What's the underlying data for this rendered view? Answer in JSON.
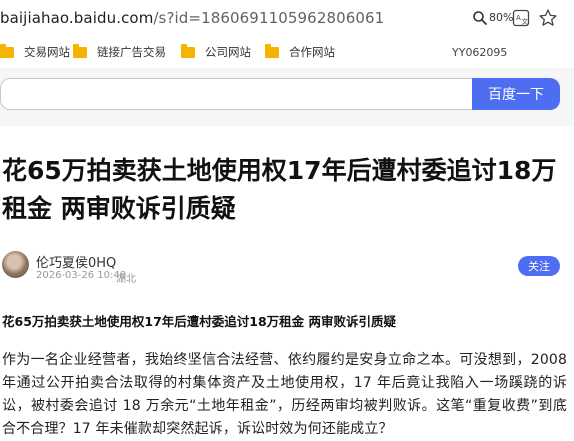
{
  "address_bar": {
    "url_host": "baijiahao.baidu.com",
    "url_path": "/s?id=1860691105962806061",
    "zoom_level": "80%"
  },
  "bookmarks": {
    "items": [
      {
        "label": "交易网站"
      },
      {
        "label": "链接广告交易"
      },
      {
        "label": "公司网站"
      },
      {
        "label": "合作网站"
      }
    ],
    "extra_text": "YY062095"
  },
  "search": {
    "input_value": "",
    "button_label": "百度一下"
  },
  "article": {
    "title": "花65万拍卖获土地使用权17年后遭村委追讨18万租金 两审败诉引质疑",
    "author_name": "伦巧夏侯0HQ",
    "publish_time": "2026-03-26 10:48",
    "publish_location": "湖北",
    "follow_label": "关注",
    "subtitle": "花65万拍卖获土地使用权17年后遭村委追讨18万租金 两审败诉引质疑",
    "body": "作为一名企业经营者，我始终坚信合法经营、依约履约是安身立命之本。可没想到，2008 年通过公开拍卖合法取得的村集体资产及土地使用权，17 年后竟让我陷入一场蹊跷的诉讼，被村委会追讨 18 万余元“土地年租金”，历经两审均被判败诉。这笔“重复收费”到底合不合理？17 年未催款却突然起诉，诉讼时效为何还能成立？"
  },
  "colors": {
    "accent": "#4e6ef2",
    "folder": "#f4b400"
  }
}
